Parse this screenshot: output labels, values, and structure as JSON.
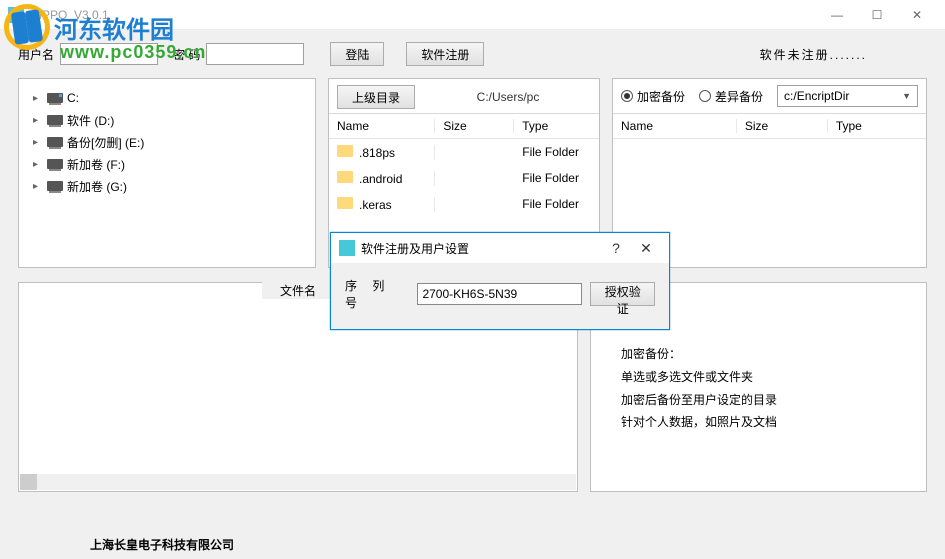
{
  "window": {
    "title": "HIPPO_V3.0.1"
  },
  "watermark": {
    "name": "河东软件园",
    "url": "www.pc0359.cn"
  },
  "toolbar": {
    "user_label": "用户名",
    "user_value": "",
    "pwd_label": "密  码",
    "pwd_value": "",
    "login_btn": "登陆",
    "register_btn": "软件注册",
    "status": "软件未注册......."
  },
  "tree": {
    "items": [
      {
        "label": "C:",
        "kind": "c"
      },
      {
        "label": "软件 (D:)",
        "kind": "d"
      },
      {
        "label": "备份[勿删] (E:)",
        "kind": "d"
      },
      {
        "label": "新加卷 (F:)",
        "kind": "d"
      },
      {
        "label": "新加卷 (G:)",
        "kind": "d"
      }
    ]
  },
  "center": {
    "up_btn": "上级目录",
    "path": "C:/Users/pc",
    "columns": {
      "name": "Name",
      "size": "Size",
      "type": "Type"
    },
    "rows": [
      {
        "name": ".818ps",
        "size": "",
        "type": "File Folder"
      },
      {
        "name": ".android",
        "size": "",
        "type": "File Folder"
      },
      {
        "name": ".keras",
        "size": "",
        "type": "File Folder"
      }
    ]
  },
  "right": {
    "radio_encrypt": "加密备份",
    "radio_diff": "差异备份",
    "combo_value": "c:/EncriptDir",
    "columns": {
      "name": "Name",
      "size": "Size",
      "type": "Type"
    }
  },
  "lower": {
    "tab_label": "文件名"
  },
  "info": {
    "h": "加密备份：",
    "l1": "单选或多选文件或文件夹",
    "l2": "加密后备份至用户设定的目录",
    "l3": "针对个人数据，如照片及文档"
  },
  "footer": {
    "company": "上海长皇电子科技有限公司"
  },
  "dialog": {
    "title": "软件注册及用户设置",
    "serial_label": "序 列 号",
    "serial_value": "2700-KH6S-5N39",
    "verify_btn": "授权验证"
  }
}
